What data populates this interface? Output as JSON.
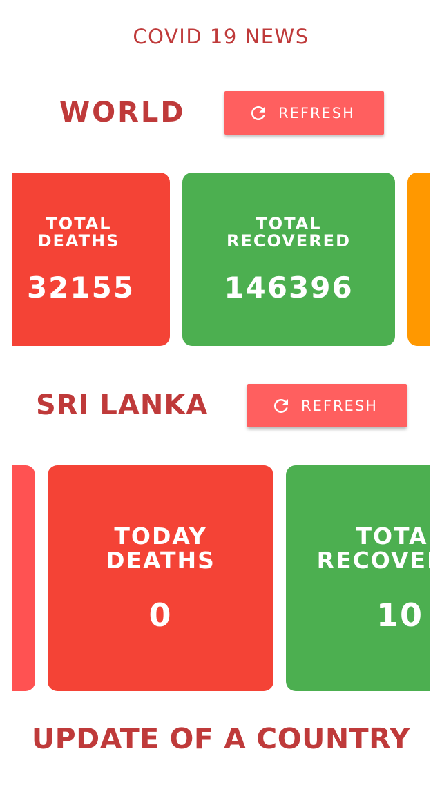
{
  "app": {
    "title": "COVID 19 NEWS"
  },
  "world": {
    "title": "WORLD",
    "refresh_label": "REFRESH",
    "cards": [
      {
        "label": "TOTAL\nDEATHS",
        "value": "32155",
        "color": "#f44336"
      },
      {
        "label": "TOTAL\nRECOVERED",
        "value": "146396",
        "color": "#4caf50"
      },
      {
        "label": "",
        "value": "",
        "color": "#ff9800"
      }
    ]
  },
  "srilanka": {
    "title": "SRI LANKA",
    "refresh_label": "REFRESH",
    "cards": [
      {
        "label": "",
        "value": "",
        "color": "#ff5252"
      },
      {
        "label": "TODAY\nDEATHS",
        "value": "0",
        "color": "#f44336"
      },
      {
        "label": "TOTAL\nRECOVERED",
        "value": "10",
        "color": "#4caf50"
      }
    ]
  },
  "footer": {
    "title": "UPDATE OF A COUNTRY"
  },
  "icons": {
    "refresh": "refresh-icon"
  },
  "colors": {
    "accent_text": "#bf3a3a",
    "button_bg": "#ff5f5f",
    "red_card": "#f44336",
    "green_card": "#4caf50",
    "orange_card": "#ff9800"
  }
}
